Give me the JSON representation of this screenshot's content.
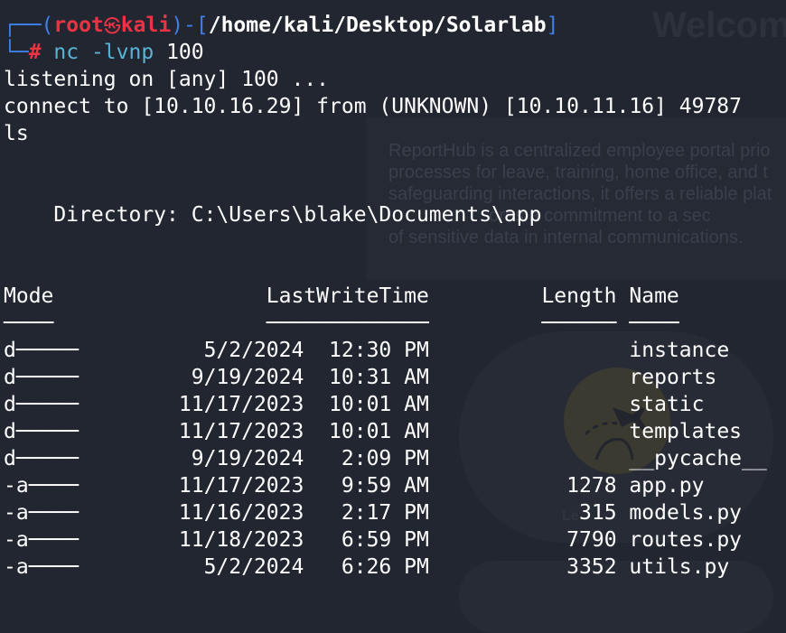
{
  "background_page": {
    "title": "Welcom",
    "description": "ReportHub is a centralized employee portal prio\nprocesses for leave, training, home office, and t\nsafeguarding interactions, it offers a reliable plat\n                    ores a commitment to a sec\nof sensitive data in internal communications.",
    "card_label": "Le"
  },
  "prompt": {
    "corner_top": "┌──(",
    "user": "root",
    "skull_glyph": "㉿",
    "host": "kali",
    "mid": ")-[",
    "path": "/home/kali/Desktop/Solarlab",
    "close": "]",
    "corner_bottom": "└─",
    "hash": "#",
    "command": "nc -lvnp",
    "arg": "100"
  },
  "output": {
    "listening": "listening on [any] 100 ...",
    "connect": "connect to [10.10.16.29] from (UNKNOWN) [10.10.11.16] 49787",
    "typed": "ls",
    "directory": "    Directory: C:\\Users\\blake\\Documents\\app"
  },
  "listing": {
    "headers": [
      "Mode",
      "LastWriteTime",
      "Length",
      "Name"
    ],
    "underlines": [
      "────",
      "─────────────",
      "──────",
      "────"
    ],
    "rows": [
      {
        "mode": "d─────",
        "date": "5/2/2024",
        "time": "12:30 PM",
        "length": "",
        "name": "instance"
      },
      {
        "mode": "d─────",
        "date": "9/19/2024",
        "time": "10:31 AM",
        "length": "",
        "name": "reports"
      },
      {
        "mode": "d─────",
        "date": "11/17/2023",
        "time": "10:01 AM",
        "length": "",
        "name": "static"
      },
      {
        "mode": "d─────",
        "date": "11/17/2023",
        "time": "10:01 AM",
        "length": "",
        "name": "templates"
      },
      {
        "mode": "d─────",
        "date": "9/19/2024",
        "time": "2:09 PM",
        "length": "",
        "name": "__pycache__"
      },
      {
        "mode": "-a────",
        "date": "11/17/2023",
        "time": "9:59 AM",
        "length": "1278",
        "name": "app.py"
      },
      {
        "mode": "-a────",
        "date": "11/16/2023",
        "time": "2:17 PM",
        "length": "315",
        "name": "models.py"
      },
      {
        "mode": "-a────",
        "date": "11/18/2023",
        "time": "6:59 PM",
        "length": "7790",
        "name": "routes.py"
      },
      {
        "mode": "-a────",
        "date": "5/2/2024",
        "time": "6:26 PM",
        "length": "3352",
        "name": "utils.py"
      }
    ]
  },
  "colors": {
    "background": "#222631",
    "prompt_blue": "#3f7fe6",
    "prompt_red": "#ec3344",
    "command_cyan": "#59b4d6",
    "text": "#ffffff"
  }
}
